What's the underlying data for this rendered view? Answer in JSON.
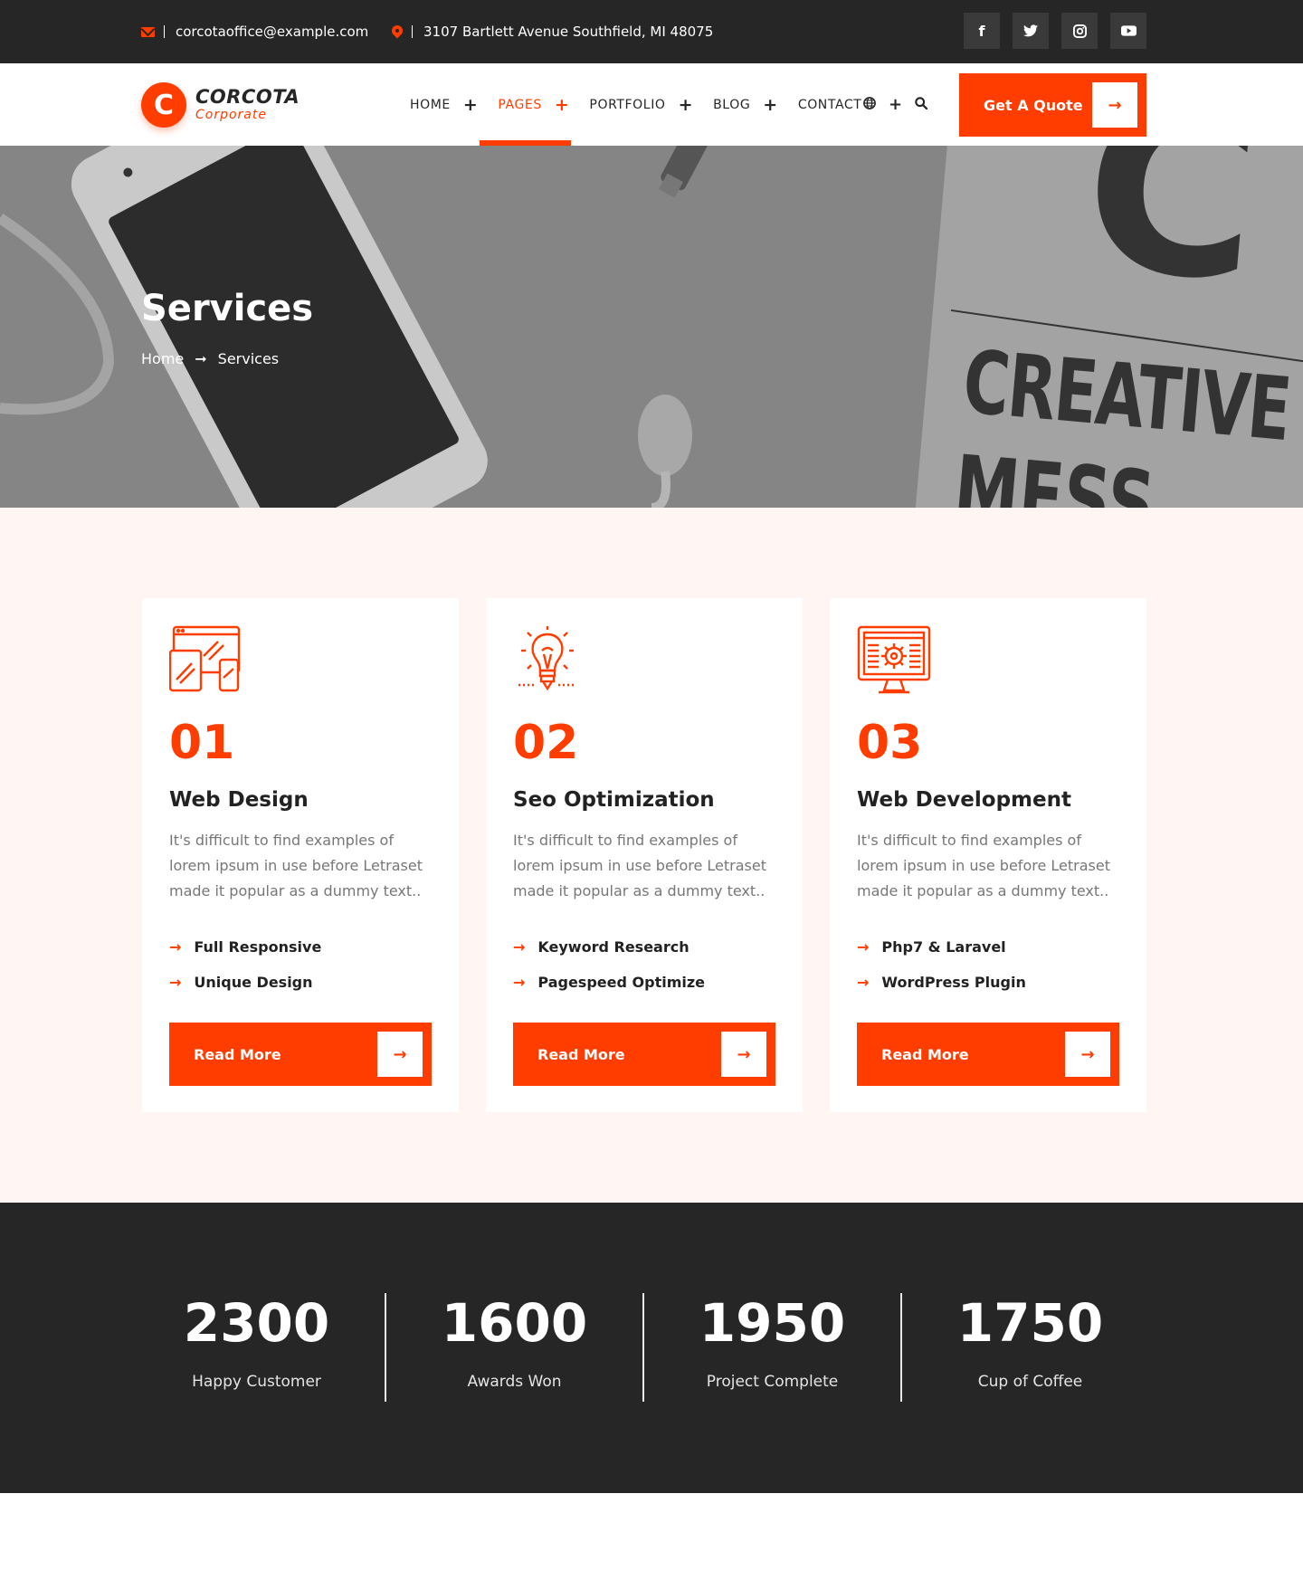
{
  "topbar": {
    "email": "corcotaoffice@example.com",
    "address": "3107 Bartlett Avenue Southfield, MI 48075",
    "socials": [
      {
        "icon": "facebook-icon",
        "glyph": "f"
      },
      {
        "icon": "twitter-icon",
        "glyph": ""
      },
      {
        "icon": "instagram-icon",
        "glyph": ""
      },
      {
        "icon": "youtube-icon",
        "glyph": ""
      }
    ]
  },
  "header": {
    "logo_mark": "C",
    "logo_name": "CORCOTA",
    "logo_sub": "Corporate",
    "nav": [
      {
        "label": "HOME",
        "has_plus": true,
        "plus": "+"
      },
      {
        "label": "PAGES",
        "has_plus": true,
        "active": true,
        "plus": "+"
      },
      {
        "label": "PORTFOLIO",
        "has_plus": true,
        "plus": "+"
      },
      {
        "label": "BLOG",
        "has_plus": true,
        "plus": "+"
      },
      {
        "label": "CONTACT",
        "has_plus": false
      }
    ],
    "lang_plus": "+",
    "quote_button": "Get A Quote",
    "arrow": "→"
  },
  "hero": {
    "title": "Services",
    "breadcrumb_home": "Home",
    "breadcrumb_arrow": "➞",
    "breadcrumb_current": "Services",
    "bg_text_1": "C",
    "bg_text_2": "CREATIVE",
    "bg_text_3": "MESS"
  },
  "services": [
    {
      "icon": "devices-icon",
      "number": "01",
      "title": "Web Design",
      "description": "It's difficult to find examples of lorem ipsum in use before Letraset made it popular as a dummy text..",
      "features": [
        "Full Responsive",
        "Unique Design"
      ],
      "button": "Read More"
    },
    {
      "icon": "lightbulb-icon",
      "number": "02",
      "title": "Seo Optimization",
      "description": "It's difficult to find examples of lorem ipsum in use before Letraset made it popular as a dummy text..",
      "features": [
        "Keyword Research",
        "Pagespeed Optimize"
      ],
      "button": "Read More"
    },
    {
      "icon": "monitor-gear-icon",
      "number": "03",
      "title": "Web Development",
      "description": "It's difficult to find examples of lorem ipsum in use before Letraset made it popular as a dummy text..",
      "features": [
        "Php7 & Laravel",
        "WordPress Plugin"
      ],
      "button": "Read More"
    }
  ],
  "feature_arrow": "→",
  "counters": [
    {
      "value": "2300",
      "label": "Happy Customer"
    },
    {
      "value": "1600",
      "label": "Awards Won"
    },
    {
      "value": "1950",
      "label": "Project Complete"
    },
    {
      "value": "1750",
      "label": "Cup of Coffee"
    }
  ],
  "colors": {
    "accent": "#ff3d00",
    "dark": "#262626",
    "section_bg": "#fff5f2"
  }
}
